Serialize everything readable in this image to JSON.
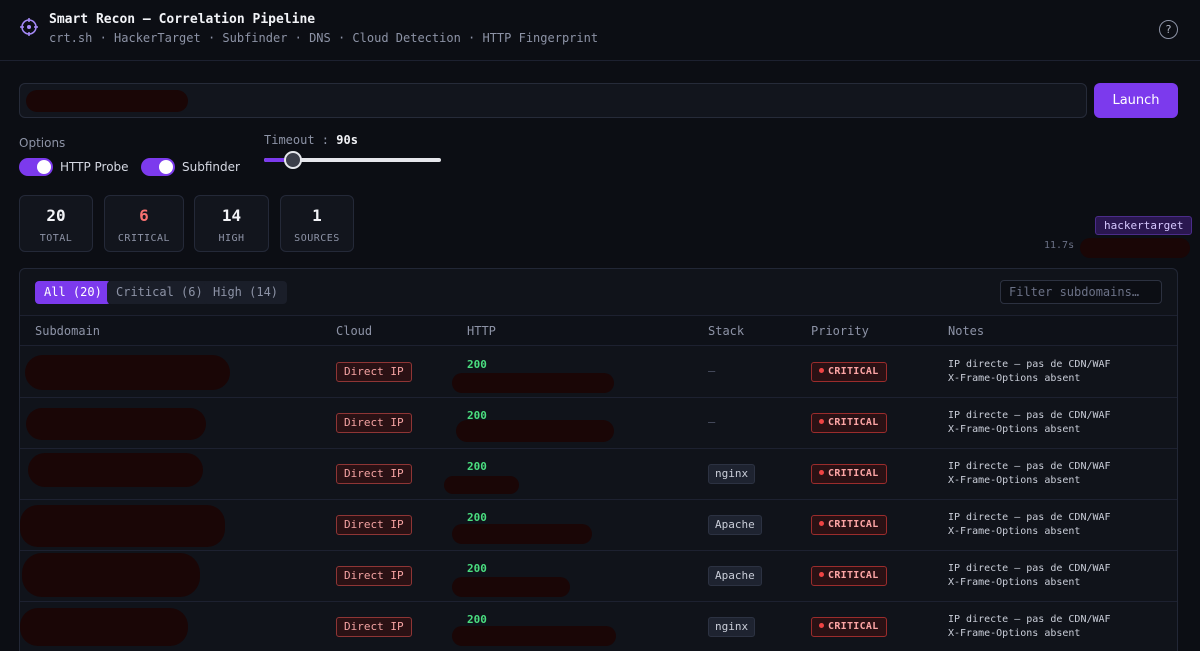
{
  "header": {
    "title": "Smart Recon — Correlation Pipeline",
    "subtitle": "crt.sh · HackerTarget · Subfinder · DNS · Cloud Detection · HTTP Fingerprint",
    "help_label": "?"
  },
  "search": {
    "value": "",
    "launch_label": "Launch"
  },
  "options": {
    "label": "Options",
    "http_probe": {
      "label": "HTTP Probe",
      "enabled": true
    },
    "subfinder": {
      "label": "Subfinder",
      "enabled": true
    },
    "timeout_label": "Timeout :",
    "timeout_value": "90s",
    "timeout_fraction": 0.2
  },
  "stats": [
    {
      "value": "20",
      "label": "TOTAL"
    },
    {
      "value": "6",
      "label": "CRITICAL"
    },
    {
      "value": "14",
      "label": "HIGH"
    },
    {
      "value": "1",
      "label": "SOURCES"
    }
  ],
  "source": {
    "name": "hackertarget",
    "elapsed": "11.7s"
  },
  "filters": {
    "tabs": [
      "All (20)",
      "Critical (6)",
      "High (14)"
    ],
    "active": 0,
    "placeholder": "Filter subdomains…"
  },
  "table": {
    "columns": [
      "Subdomain",
      "Cloud",
      "HTTP",
      "Stack",
      "Priority",
      "Notes"
    ],
    "rows": [
      {
        "cloud": "Direct IP",
        "http": "200",
        "stack": "—",
        "priority": "CRITICAL",
        "note1": "IP directe — pas de CDN/WAF",
        "note2": "X-Frame-Options absent"
      },
      {
        "cloud": "Direct IP",
        "http": "200",
        "stack": "—",
        "priority": "CRITICAL",
        "note1": "IP directe — pas de CDN/WAF",
        "note2": "X-Frame-Options absent"
      },
      {
        "cloud": "Direct IP",
        "http": "200",
        "stack": "nginx",
        "priority": "CRITICAL",
        "note1": "IP directe — pas de CDN/WAF",
        "note2": "X-Frame-Options absent"
      },
      {
        "cloud": "Direct IP",
        "http": "200",
        "stack": "Apache",
        "priority": "CRITICAL",
        "note1": "IP directe — pas de CDN/WAF",
        "note2": "X-Frame-Options absent"
      },
      {
        "cloud": "Direct IP",
        "http": "200",
        "stack": "Apache",
        "priority": "CRITICAL",
        "note1": "IP directe — pas de CDN/WAF",
        "note2": "X-Frame-Options absent"
      },
      {
        "cloud": "Direct IP",
        "http": "200",
        "stack": "nginx",
        "priority": "CRITICAL",
        "note1": "IP directe — pas de CDN/WAF",
        "note2": "X-Frame-Options absent"
      }
    ]
  },
  "colors": {
    "accent": "#7c3aed",
    "critical": "#f87171",
    "http_ok": "#4ade80",
    "background": "#0c0e14"
  },
  "icons": {
    "logo": "crosshair-icon",
    "help": "help-circle-icon"
  }
}
